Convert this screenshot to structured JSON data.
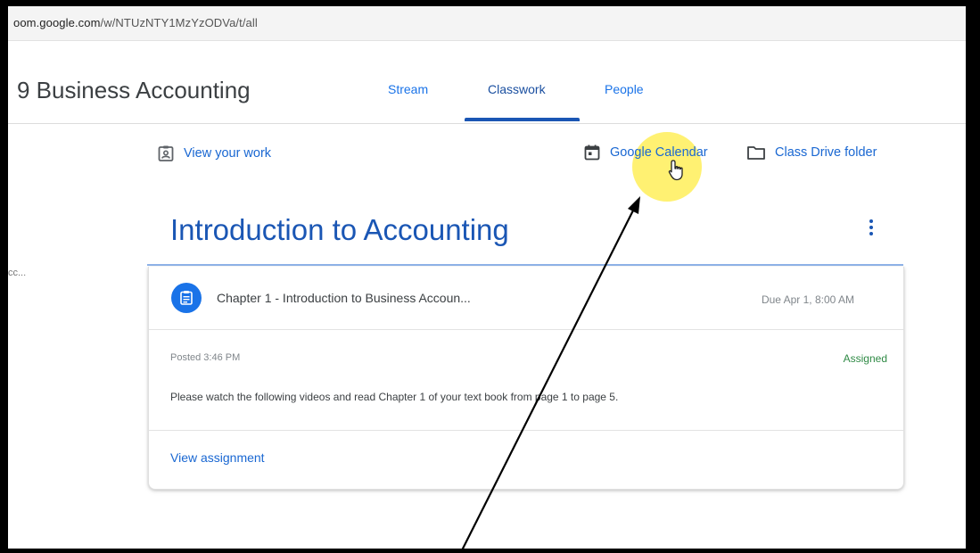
{
  "browser": {
    "url_host": "oom.google.com",
    "url_path": "/w/NTUzNTY1MzYzODVa/t/all"
  },
  "header": {
    "class_title": "9 Business Accounting",
    "tabs": [
      {
        "label": "Stream",
        "active": false
      },
      {
        "label": "Classwork",
        "active": true
      },
      {
        "label": "People",
        "active": false
      }
    ]
  },
  "actions": {
    "view_work": "View your work",
    "google_calendar": "Google Calendar",
    "class_drive": "Class Drive folder"
  },
  "sidebar": {
    "truncated_item": "cc..."
  },
  "topic": {
    "title": "Introduction to Accounting"
  },
  "assignment": {
    "title": "Chapter 1 - Introduction to Business Accoun...",
    "due": "Due Apr 1, 8:00 AM",
    "posted": "Posted 3:46 PM",
    "status": "Assigned",
    "description": "Please watch the following videos and read Chapter 1 of your text book from page 1 to page 5.",
    "view_link": "View assignment"
  },
  "colors": {
    "accent": "#1a73e8",
    "topic_title": "#1a56b4",
    "status_assigned": "#2f8a45",
    "highlight": "#ffeb3b"
  },
  "icons": [
    "assignment-ind-icon",
    "calendar-icon",
    "folder-icon",
    "assignment-icon",
    "kebab-menu-icon",
    "hand-cursor-icon"
  ]
}
